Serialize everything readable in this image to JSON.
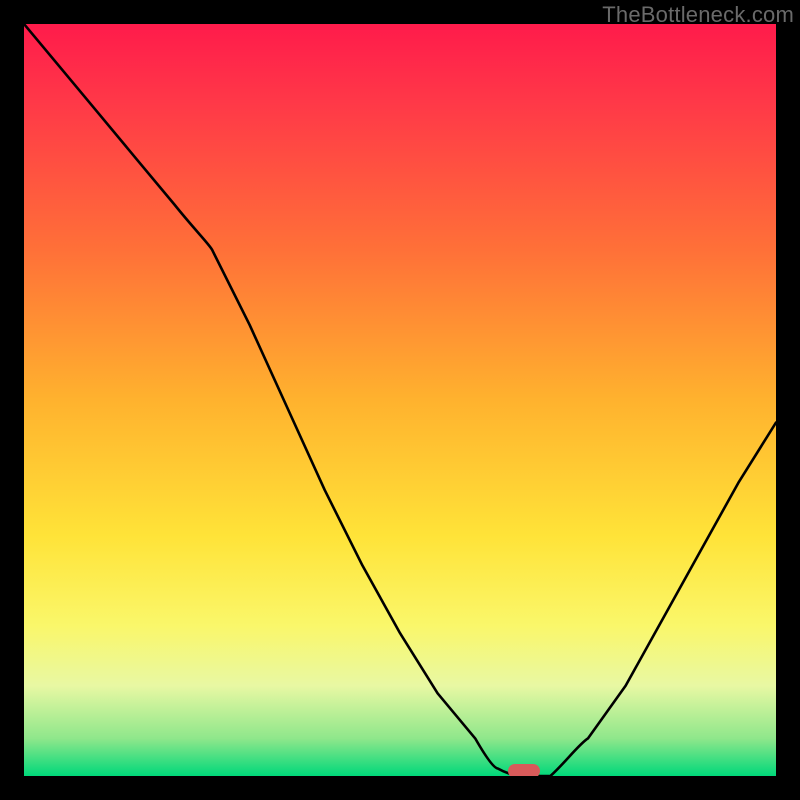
{
  "watermark": "TheBottleneck.com",
  "chart_data": {
    "type": "line",
    "title": "",
    "xlabel": "",
    "ylabel": "",
    "xlim": [
      0,
      100
    ],
    "ylim": [
      0,
      100
    ],
    "x": [
      0,
      5,
      10,
      15,
      20,
      25,
      30,
      35,
      40,
      45,
      50,
      55,
      60,
      63,
      66,
      70,
      75,
      80,
      85,
      90,
      95,
      100
    ],
    "values": [
      100,
      94,
      88,
      82,
      76,
      70,
      60,
      49,
      38,
      28,
      19,
      11,
      5,
      1,
      0,
      0,
      5,
      12,
      21,
      30,
      39,
      47
    ],
    "minimum_marker_x": 66,
    "legend": false,
    "grid": false
  },
  "colors": {
    "gradient_top": "#ff1b4b",
    "gradient_bottom": "#00d87a",
    "curve": "#000000",
    "marker": "#d85a5a",
    "background": "#000000"
  }
}
